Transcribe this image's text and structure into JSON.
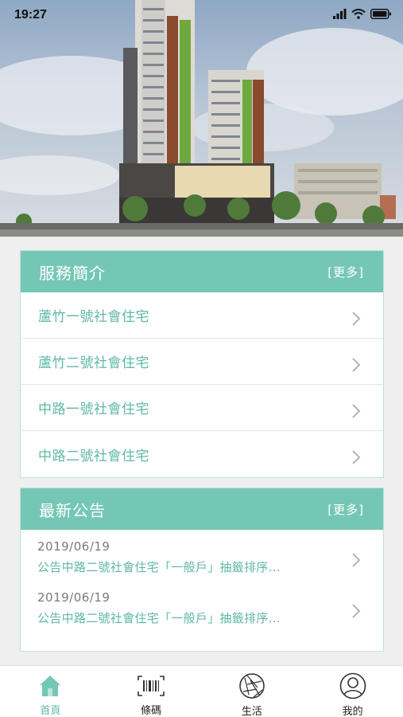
{
  "status_bar": {
    "time": "19:27"
  },
  "services": {
    "title": "服務簡介",
    "more": "[更多]",
    "items": [
      {
        "label": "蘆竹一號社會住宅"
      },
      {
        "label": "蘆竹二號社會住宅"
      },
      {
        "label": "中路一號社會住宅"
      },
      {
        "label": "中路二號社會住宅"
      }
    ]
  },
  "news": {
    "title": "最新公告",
    "more": "[更多]",
    "items": [
      {
        "date": "2019/06/19",
        "title": "公告中路二號社會住宅「一般戶」抽籤排序..."
      },
      {
        "date": "2019/06/19",
        "title": "公告中路二號社會住宅「一般戶」抽籤排序..."
      }
    ]
  },
  "tabs": [
    {
      "label": "首頁",
      "icon": "home-icon",
      "active": true
    },
    {
      "label": "條碼",
      "icon": "barcode-icon",
      "active": false
    },
    {
      "label": "生活",
      "icon": "aperture-icon",
      "active": false
    },
    {
      "label": "我的",
      "icon": "user-icon",
      "active": false
    }
  ],
  "colors": {
    "accent": "#75c7b5",
    "accent_text": "#5fb8a6"
  }
}
